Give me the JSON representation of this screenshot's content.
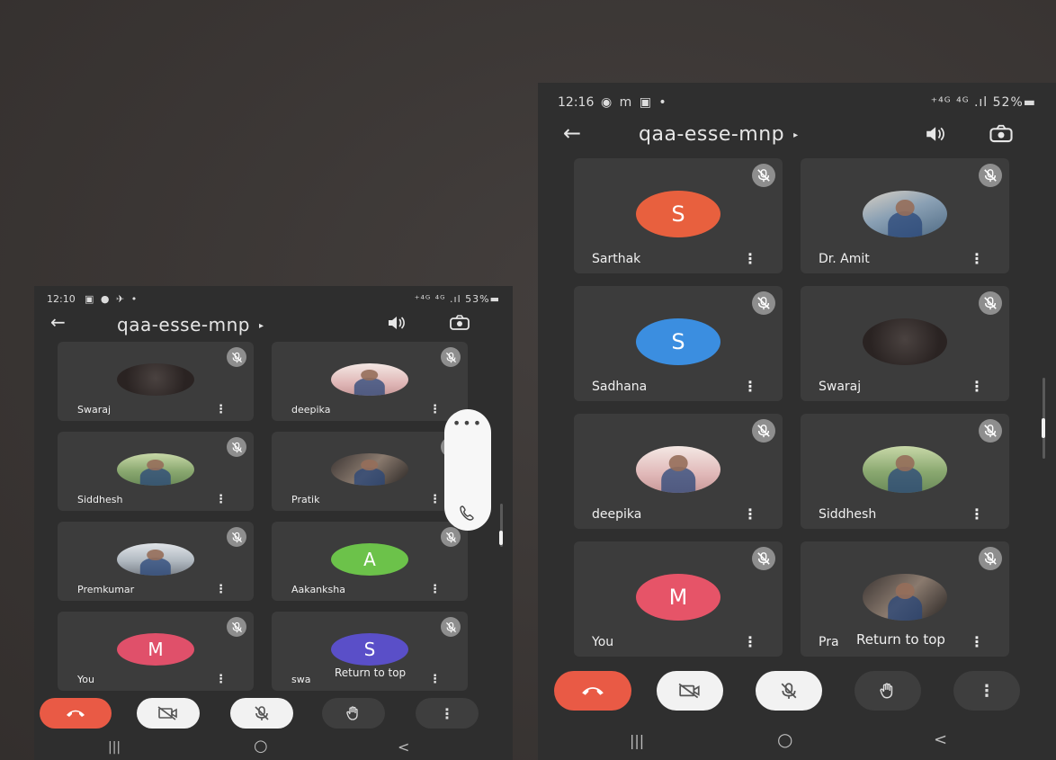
{
  "left_phone": {
    "status": {
      "time": "12:10",
      "icons": "▣ ● ✈ •",
      "right": "⁺⁴ᴳ ⁴ᴳ .ıl 53%▬"
    },
    "title": "qaa-esse-mnp",
    "caret": "▸",
    "back_icon": "arrow-left-icon",
    "speaker_icon": "speaker-icon",
    "switch_camera_icon": "switch-camera-icon",
    "tiles": [
      {
        "name": "Swaraj",
        "avatar": "photo",
        "initial": ""
      },
      {
        "name": "deepika",
        "avatar": "photo",
        "initial": ""
      },
      {
        "name": "Siddhesh",
        "avatar": "photo",
        "initial": ""
      },
      {
        "name": "Pratik",
        "avatar": "photo",
        "initial": ""
      },
      {
        "name": "Premkumar",
        "avatar": "photo",
        "initial": ""
      },
      {
        "name": "Aakanksha",
        "avatar": "initial",
        "initial": "A",
        "color": "#6cc24a"
      },
      {
        "name": "You",
        "avatar": "initial",
        "initial": "M",
        "color": "#e0506a"
      },
      {
        "name": "swa",
        "avatar": "initial",
        "initial": "S",
        "color": "#5a4fc8"
      }
    ],
    "return_to_top": "Return to top",
    "kebab": "⋮",
    "floating_panel": {
      "dots": "•••",
      "icon": "phone-icon"
    },
    "controls": [
      "end-call",
      "video-off",
      "mic-off",
      "raise-hand",
      "more"
    ],
    "nav": [
      "|||",
      "○",
      "<"
    ]
  },
  "right_phone": {
    "status": {
      "time": "12:16",
      "icons": "◉ m ▣ •",
      "right": "⁺⁴ᴳ ⁴ᴳ .ıl 52%▬"
    },
    "title": "qaa-esse-mnp",
    "caret": "▸",
    "back_icon": "arrow-left-icon",
    "speaker_icon": "speaker-icon",
    "switch_camera_icon": "switch-camera-icon",
    "tiles": [
      {
        "name": "Sarthak",
        "avatar": "initial",
        "initial": "S",
        "color": "#e8603e"
      },
      {
        "name": "Dr. Amit",
        "avatar": "photo",
        "initial": ""
      },
      {
        "name": "Sadhana",
        "avatar": "initial",
        "initial": "S",
        "color": "#3b8ee0"
      },
      {
        "name": "Swaraj",
        "avatar": "photo",
        "initial": ""
      },
      {
        "name": "deepika",
        "avatar": "photo",
        "initial": ""
      },
      {
        "name": "Siddhesh",
        "avatar": "photo",
        "initial": ""
      },
      {
        "name": "You",
        "avatar": "initial",
        "initial": "M",
        "color": "#e65468"
      },
      {
        "name": "Pra",
        "avatar": "photo",
        "initial": ""
      }
    ],
    "return_to_top": "Return to top",
    "kebab": "⋮",
    "controls": [
      "end-call",
      "video-off",
      "mic-off",
      "raise-hand",
      "more"
    ],
    "nav": [
      "|||",
      "○",
      "<"
    ]
  },
  "colors": {
    "end_call": "#e95a45",
    "tile_bg": "#3c3c3c",
    "mute_chip": "#8e8e8e"
  }
}
